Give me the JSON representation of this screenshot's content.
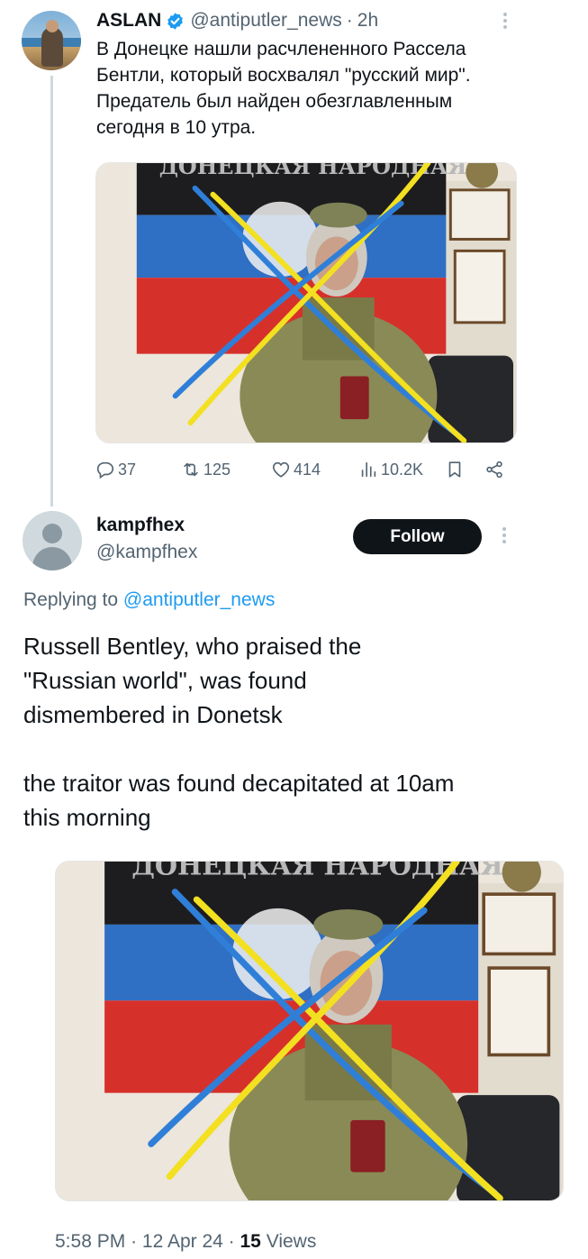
{
  "original_tweet": {
    "author_name": "ASLAN",
    "handle": "@antiputler_news",
    "separator": "·",
    "time": "2h",
    "text": "В Донецке нашли расчлененного Рассела Бентли, который восхвалял \"русский мир\". Предатель был найден обезглавленным сегодня в 10 утра.",
    "image_banner_text": "ДОНЕЦКАЯ НАРОДНАЯ",
    "stats": {
      "replies": "37",
      "retweets": "125",
      "likes": "414",
      "views": "10.2K"
    }
  },
  "reply_tweet": {
    "author_name": "kampfhex",
    "handle": "@kampfhex",
    "follow_label": "Follow",
    "replying_prefix": "Replying to",
    "replying_handle": "@antiputler_news",
    "paragraph_1": "Russell Bentley, who praised the \"Russian world\", was found dismembered in Donetsk",
    "paragraph_2": "the traitor was found decapitated at 10am this morning",
    "image_banner_text": "ДОНЕЦКАЯ НАРОДНАЯ",
    "time": "5:58 PM",
    "date": "12 Apr 24",
    "separator": "·",
    "views_count": "15",
    "views_label": "Views"
  },
  "icons": {
    "verified": "verified-badge-icon",
    "reply": "reply-icon",
    "retweet": "retweet-icon",
    "like": "heart-icon",
    "views": "views-bar-chart-icon",
    "bookmark": "bookmark-icon",
    "share": "share-icon",
    "more": "more-vertical-icon"
  },
  "colors": {
    "text_primary": "#0f1419",
    "text_secondary": "#536471",
    "link": "#1d9bf0",
    "verified": "#1d9bf0",
    "follow_bg": "#0f1419",
    "flag_black": "#1d1d1f",
    "flag_blue": "#2f6fc4",
    "flag_red": "#d6302b",
    "cross_yellow": "#f3e021",
    "cross_blue": "#2f7fd8"
  }
}
